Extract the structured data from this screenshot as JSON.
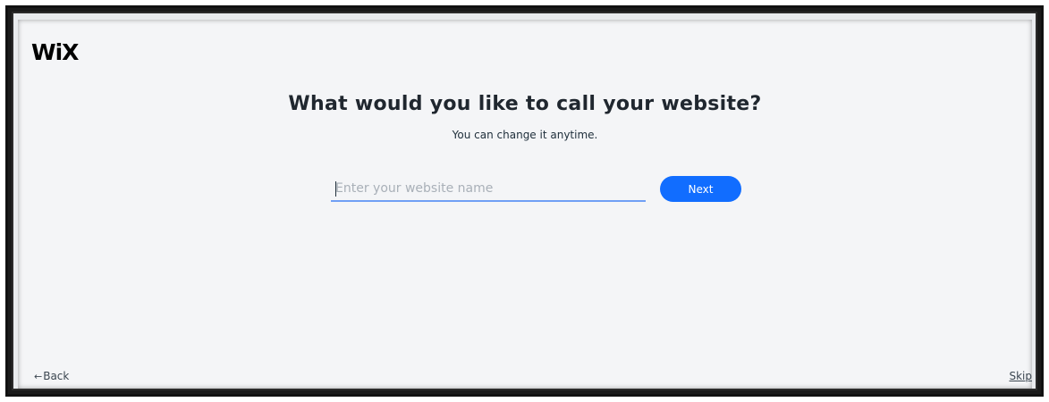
{
  "brand": {
    "logo_text": "WiX",
    "accent_color": "#116dff"
  },
  "main": {
    "title": "What would you like to call your website?",
    "subtitle": "You can change it anytime.",
    "name_input": {
      "value": "",
      "placeholder": "Enter your website name"
    },
    "next_label": "Next"
  },
  "footer": {
    "back_arrow": "←",
    "back_label": "Back",
    "skip_label": "Skip"
  },
  "icons": {
    "back": "arrow-left-icon"
  }
}
